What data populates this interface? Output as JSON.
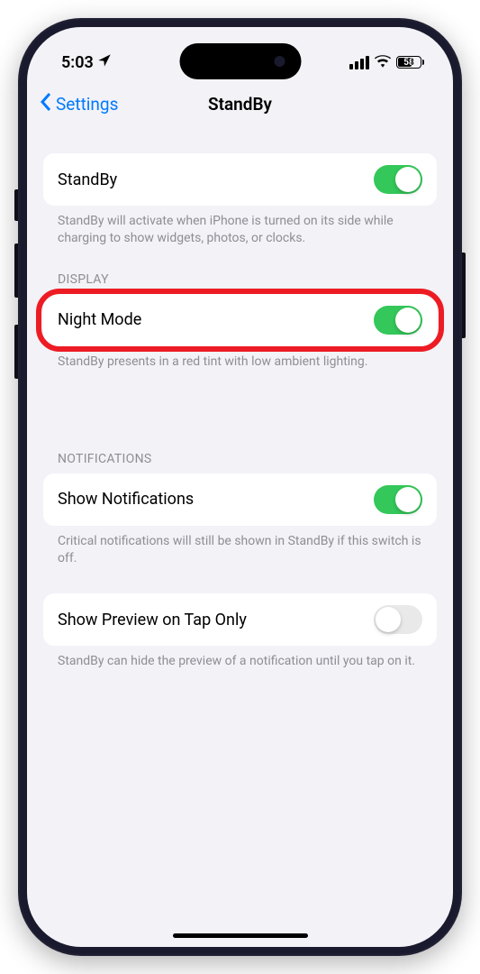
{
  "status": {
    "time": "5:03",
    "battery_percent": "58"
  },
  "nav": {
    "back_label": "Settings",
    "title": "StandBy"
  },
  "sections": [
    {
      "header": "",
      "cells": [
        {
          "label": "StandBy",
          "toggle": true,
          "highlighted": false
        }
      ],
      "footer": "StandBy will activate when iPhone is turned on its side while charging to show widgets, photos, or clocks."
    },
    {
      "header": "DISPLAY",
      "cells": [
        {
          "label": "Night Mode",
          "toggle": true,
          "highlighted": true
        }
      ],
      "footer": "StandBy presents in a red tint with low ambient lighting."
    },
    {
      "header": "NOTIFICATIONS",
      "cells": [
        {
          "label": "Show Notifications",
          "toggle": true,
          "highlighted": false
        }
      ],
      "footer": "Critical notifications will still be shown in StandBy if this switch is off."
    },
    {
      "header": "",
      "cells": [
        {
          "label": "Show Preview on Tap Only",
          "toggle": false,
          "highlighted": false
        }
      ],
      "footer": "StandBy can hide the preview of a notification until you tap on it."
    }
  ]
}
